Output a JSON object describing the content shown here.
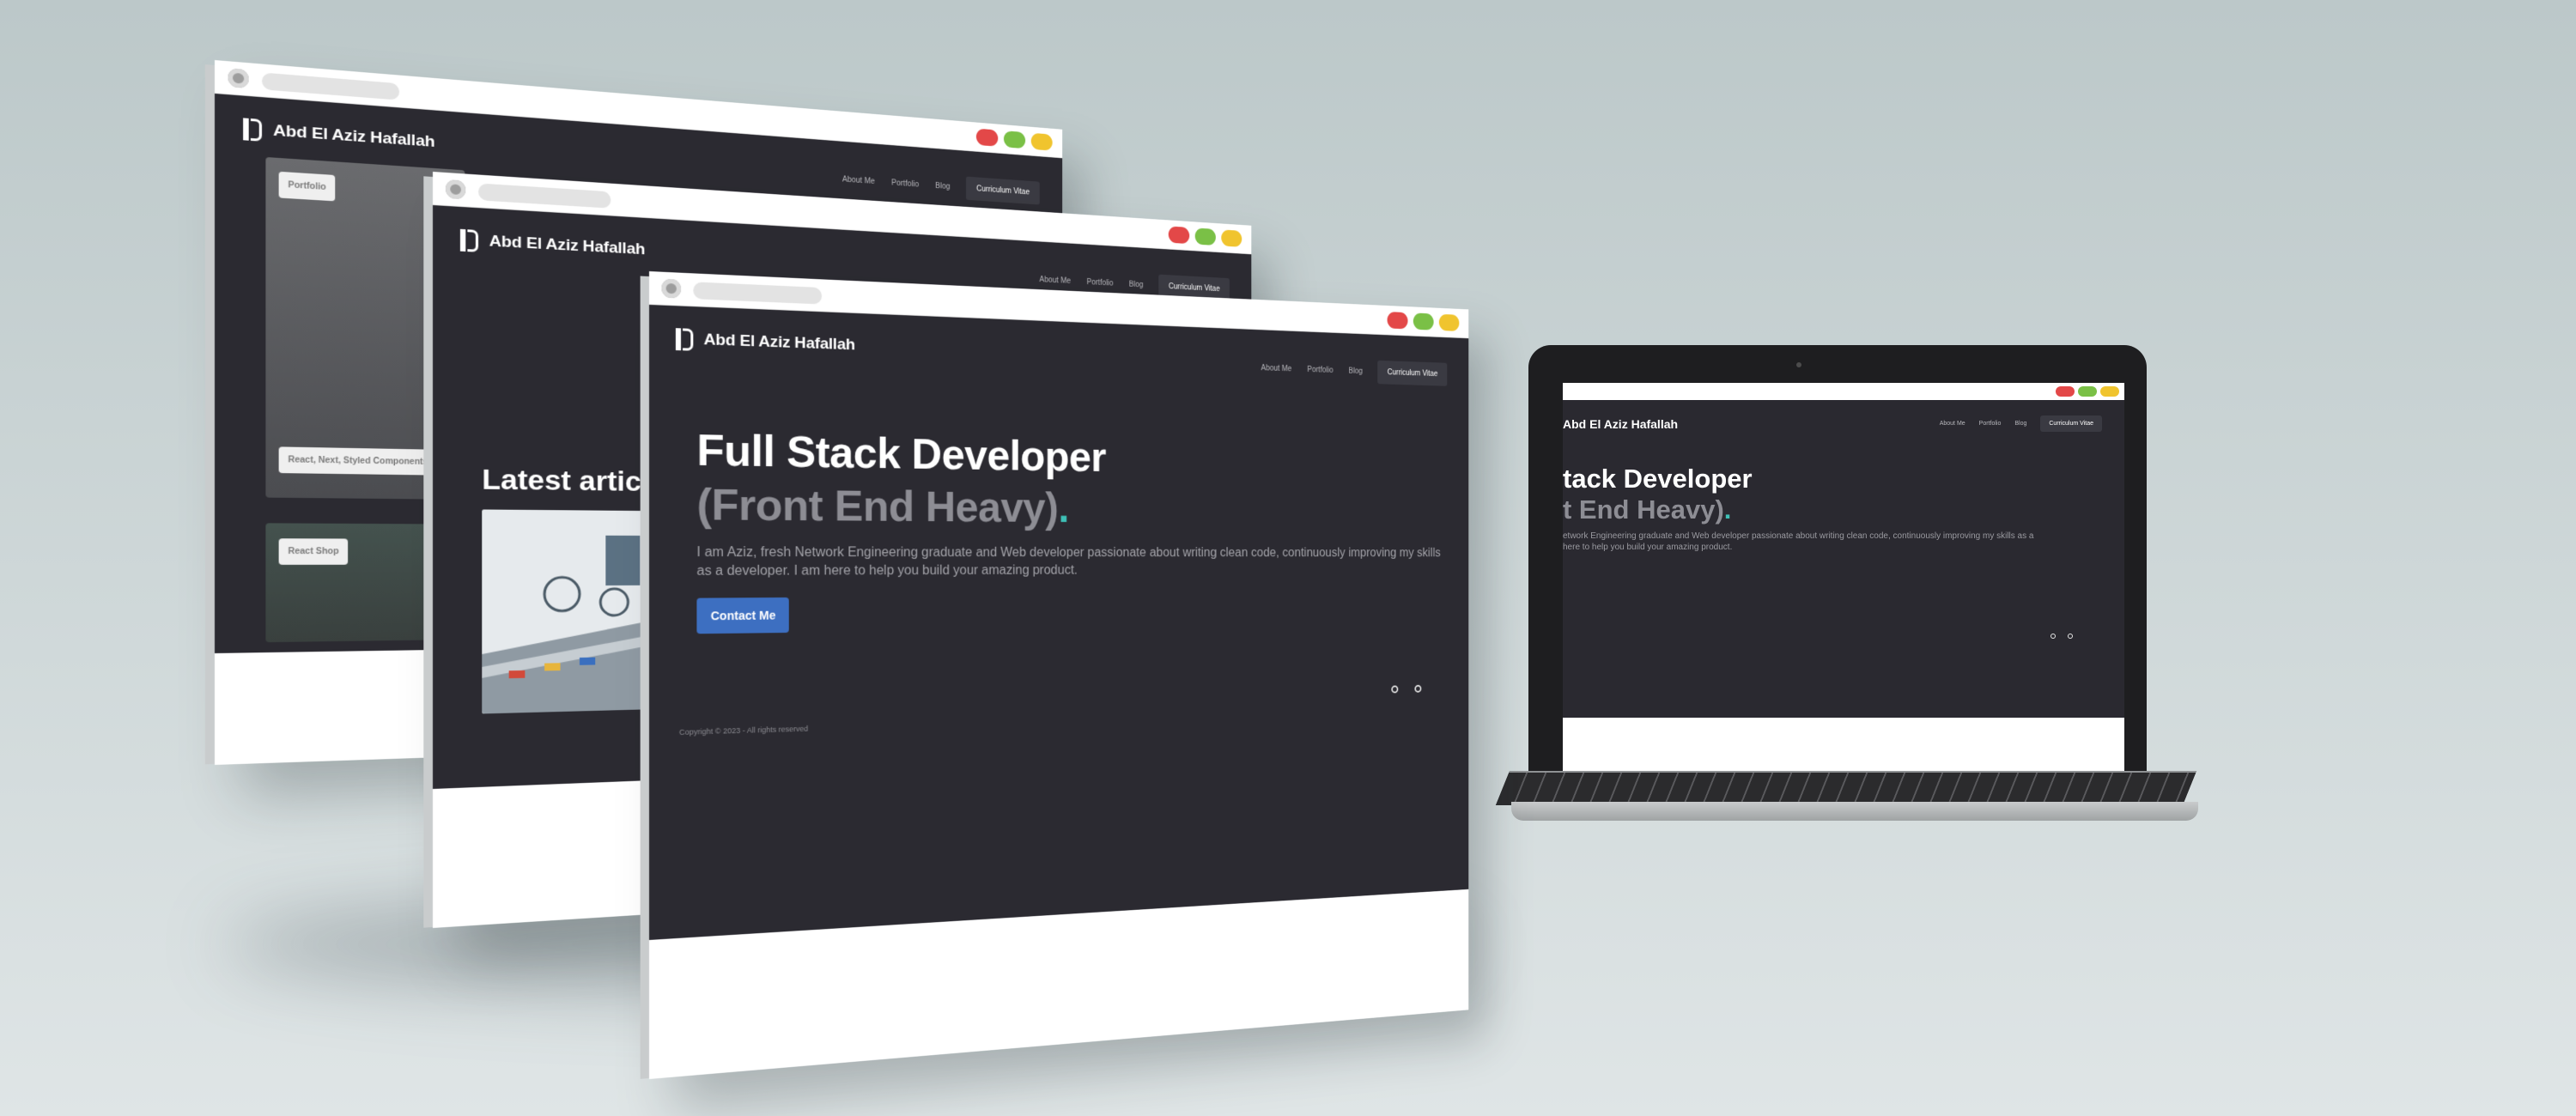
{
  "site": {
    "name": "Abd El Aziz Hafallah",
    "nav": {
      "about": "About Me",
      "portfolio": "Portfolio",
      "blog": "Blog",
      "cv": "Curriculum Vitae"
    }
  },
  "window_controls": {
    "colors": {
      "red": "#e34848",
      "green": "#7ac046",
      "yellow": "#f0c42e"
    }
  },
  "hero": {
    "title": "Full Stack Developer",
    "subtitle": "(Front End Heavy)",
    "period": ".",
    "description": "I am Aziz, fresh Network Engineering graduate and Web developer passionate about writing clean code, continuously improving my skills as a developer. I am here to help you build your amazing product.",
    "contact_button": "Contact Me",
    "icons": [
      "github-icon",
      "linkedin-icon"
    ],
    "copyright": "Copyright © 2023 - All rights reserved"
  },
  "portfolio_window": {
    "chip_portfolio": "Portfolio",
    "chip_stack": "React, Next, Styled Components",
    "chip_react_shop": "React Shop"
  },
  "blog_window": {
    "latest_articles": "Latest article"
  },
  "laptop": {
    "hero_title_fragment": "tack Developer",
    "hero_subtitle_fragment": "t End Heavy)",
    "description_fragment": "etwork Engineering graduate and Web developer passionate about writing clean code, continuously improving my skills as a\nhere to help you build your amazing product."
  },
  "colors": {
    "page_bg": "#2b2a31",
    "accent_blue": "#3d6fc1",
    "accent_teal": "#3ec0b6"
  }
}
